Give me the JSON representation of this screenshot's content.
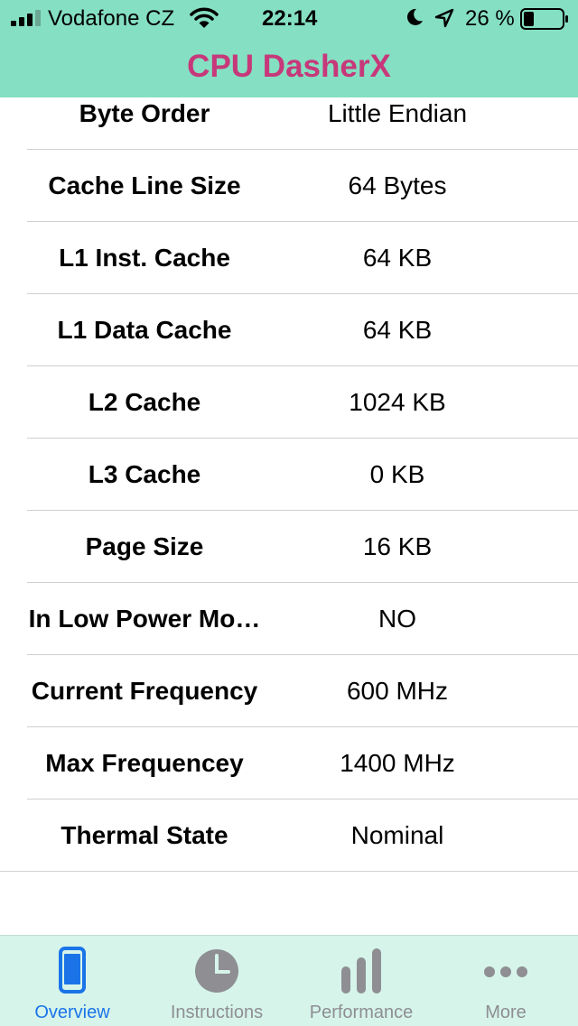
{
  "status_bar": {
    "carrier": "Vodafone CZ",
    "time": "22:14",
    "battery_percent": "26 %",
    "battery_level": 0.26,
    "icons": [
      "signal-icon",
      "wifi-icon",
      "moon-icon",
      "location-arrow-icon",
      "battery-icon"
    ]
  },
  "app": {
    "title": "CPU DasherX"
  },
  "rows": [
    {
      "label": "Byte Order",
      "value": "Little Endian"
    },
    {
      "label": "Cache Line Size",
      "value": "64 Bytes"
    },
    {
      "label": "L1 Inst. Cache",
      "value": "64 KB"
    },
    {
      "label": "L1 Data Cache",
      "value": "64 KB"
    },
    {
      "label": "L2 Cache",
      "value": "1024 KB"
    },
    {
      "label": "L3 Cache",
      "value": "0 KB"
    },
    {
      "label": "Page Size",
      "value": "16 KB"
    },
    {
      "label": "In Low Power Mo…",
      "value": "NO"
    },
    {
      "label": "Current Frequency",
      "value": "600 MHz"
    },
    {
      "label": "Max Frequencey",
      "value": "1400 MHz"
    },
    {
      "label": "Thermal State",
      "value": "Nominal"
    }
  ],
  "tabs": [
    {
      "label": "Overview",
      "icon": "phone-icon",
      "active": true
    },
    {
      "label": "Instructions",
      "icon": "clock-icon",
      "active": false
    },
    {
      "label": "Performance",
      "icon": "bar-chart-icon",
      "active": false
    },
    {
      "label": "More",
      "icon": "more-dots-icon",
      "active": false
    }
  ],
  "colors": {
    "header_bg": "#85dfc2",
    "title": "#c7387a",
    "tab_bar_bg": "#d6f4ea",
    "tab_active": "#1a74e8",
    "tab_inactive": "#8e8e93"
  }
}
